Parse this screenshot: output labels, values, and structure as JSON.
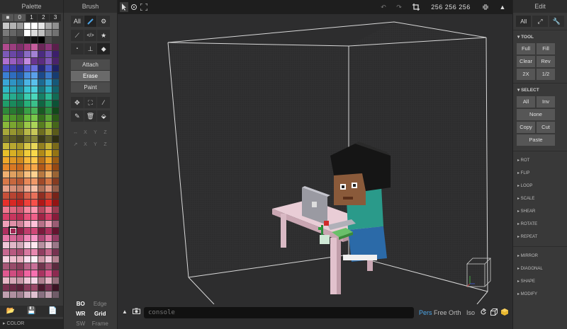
{
  "palette": {
    "title": "Palette",
    "tabs": [
      "■",
      "0",
      "1",
      "2",
      "3"
    ],
    "swatches": [
      "#c9c9c9",
      "#b3b3b3",
      "#9b9b9b",
      "#ffffff",
      "#ffffff",
      "#e6e6e6",
      "#a8a8a8",
      "#909090",
      "#7a7a7a",
      "#666666",
      "#555555",
      "#ffffff",
      "#dcdcdc",
      "#c0c0c0",
      "#828282",
      "#727272",
      "#515151",
      "#3f3f3f",
      "#2f2f2f",
      "#1f1f1f",
      "#111111",
      "#000000",
      "#4b4b4b",
      "#3a3a3a",
      "#b04a8e",
      "#9b3e7f",
      "#7e2f6a",
      "#a33a7e",
      "#c45d9c",
      "#6a2558",
      "#8b3578",
      "#5a1f4b",
      "#7c5ab8",
      "#6a47a6",
      "#5a3793",
      "#8a6bc4",
      "#a382d4",
      "#4a2b80",
      "#6f4fb0",
      "#3c1f6b",
      "#b070d0",
      "#9a5ec0",
      "#8248a8",
      "#c48ae0",
      "#6a3590",
      "#5b2d80",
      "#7e55b4",
      "#4a236b",
      "#4b4fc4",
      "#3d42b0",
      "#2e3398",
      "#5a60d4",
      "#6b72e0",
      "#24287a",
      "#4a5ac8",
      "#1e2266",
      "#3a7fd4",
      "#2f6dbf",
      "#245aa8",
      "#4a90e0",
      "#5aa0ea",
      "#1c4a8a",
      "#3a78c8",
      "#173c70",
      "#3aa6d8",
      "#2f94c4",
      "#2480ae",
      "#4ab4e4",
      "#5ac0ec",
      "#1c6a92",
      "#34a0d0",
      "#165878",
      "#2fb8c8",
      "#26a4b4",
      "#1c8e9e",
      "#3ac6d4",
      "#4ad0dc",
      "#167880",
      "#2ab0c0",
      "#12626a",
      "#2fbfa0",
      "#26ab8e",
      "#1c967a",
      "#3acdb0",
      "#4ad8bc",
      "#168066",
      "#2ab894",
      "#126a54",
      "#1f9e6a",
      "#1a8a5c",
      "#147a50",
      "#26b07a",
      "#3ac08a",
      "#106642",
      "#1e9860",
      "#0c5236",
      "#2e8a3a",
      "#287a32",
      "#206a2a",
      "#38a046",
      "#4ab458",
      "#185a22",
      "#2e8c3c",
      "#12481a",
      "#5aa832",
      "#4e962a",
      "#428224",
      "#68bc3a",
      "#7ac84a",
      "#36701c",
      "#5aa434",
      "#2a5a16",
      "#8ab83a",
      "#7aa630",
      "#6a9228",
      "#9ac848",
      "#aad458",
      "#587e20",
      "#86b436",
      "#46661a",
      "#a8a83a",
      "#969630",
      "#828228",
      "#b8b848",
      "#c8c858",
      "#6e6e20",
      "#a2a236",
      "#5a5a1a",
      "#6a6a2a",
      "#5a5a24",
      "#4a4a1e",
      "#7a7a32",
      "#8a8a3a",
      "#3c3c18",
      "#5e5e28",
      "#2e2e12",
      "#c8b83a",
      "#b8a830",
      "#a89828",
      "#d8c848",
      "#e8d858",
      "#928020",
      "#c4b234",
      "#7a6a1a",
      "#e8c02a",
      "#d8b024",
      "#c8a01e",
      "#f0cc3a",
      "#f8d84a",
      "#b08a18",
      "#e4ba28",
      "#947414",
      "#f0a82a",
      "#e09824",
      "#d0881e",
      "#f8b83a",
      "#ffc84a",
      "#b87018",
      "#eca428",
      "#9a5c14",
      "#e8882a",
      "#d87824",
      "#c8681e",
      "#f0983a",
      "#f8a84a",
      "#b05818",
      "#e48428",
      "#944814",
      "#f0b070",
      "#e0a060",
      "#d09050",
      "#f8c080",
      "#ffd090",
      "#b87840",
      "#eeb26c",
      "#9a6434",
      "#d87848",
      "#c8683e",
      "#b85834",
      "#e88858",
      "#f09868",
      "#a04a2a",
      "#d47444",
      "#863c22",
      "#e8a088",
      "#d89078",
      "#c88068",
      "#f0b098",
      "#f8c0a8",
      "#b07058",
      "#e49c84",
      "#945c48",
      "#c8503a",
      "#b84432",
      "#a8382a",
      "#d8604a",
      "#e8705a",
      "#902e22",
      "#c44c36",
      "#76241a",
      "#e8302a",
      "#d82824",
      "#c8201e",
      "#f0403a",
      "#f8504a",
      "#b01818",
      "#e42c28",
      "#941414",
      "#f07890",
      "#e06880",
      "#d05870",
      "#f888a0",
      "#ff98b0",
      "#b84860",
      "#ec748c",
      "#9a3a50",
      "#d8406a",
      "#c8365e",
      "#b82c52",
      "#e8507a",
      "#f0608a",
      "#a02446",
      "#d43c66",
      "#861c3a",
      "#f0a0b8",
      "#e090a8",
      "#d08098",
      "#f8b0c8",
      "#ffc0d8",
      "#b87088",
      "#ec9cb4",
      "#9a5c74",
      "#b03060",
      "#a02854",
      "#902048",
      "#c03c6c",
      "#d04878",
      "#7a1a3c",
      "#ac2e5c",
      "#641430",
      "#e878a8",
      "#d86898",
      "#c85888",
      "#f088b8",
      "#f898c8",
      "#b04878",
      "#e474a4",
      "#943c64",
      "#f0c8d8",
      "#e0b8c8",
      "#d0a8b8",
      "#f8d8e8",
      "#ffe8f0",
      "#b890a0",
      "#ecc4d4",
      "#9a7888",
      "#c86890",
      "#b85a80",
      "#a84c70",
      "#d878a0",
      "#e888b0",
      "#903e60",
      "#c46489",
      "#763250",
      "#f8d0e0",
      "#f0c0d0",
      "#e8b0c0",
      "#ffe0f0",
      "#fff0f8",
      "#d098a8",
      "#f4cadc",
      "#b48090",
      "#a85878",
      "#984c6a",
      "#88405c",
      "#b86488",
      "#c87098",
      "#70344c",
      "#a45474",
      "#5a2a3e",
      "#e05890",
      "#d04c80",
      "#c04070",
      "#f064a0",
      "#f870b0",
      "#a83460",
      "#dc548c",
      "#8c2a50",
      "#e8b8c8",
      "#d8a8b8",
      "#c898a8",
      "#f0c8d8",
      "#f8d8e8",
      "#b08090",
      "#e4b4c4",
      "#946c7a",
      "#7a3050",
      "#6a2844",
      "#5a2038",
      "#8a3c5c",
      "#9a4868",
      "#4a182c",
      "#763050",
      "#3c1424",
      "#c0a0b0",
      "#b090a0",
      "#a08090",
      "#d0b0c0",
      "#e0c0d0",
      "#887080",
      "#bc9cac",
      "#705c68"
    ],
    "selected_swatch": 233,
    "footer_icons": [
      "folder-open-icon",
      "save-icon",
      "file-icon"
    ],
    "footer_glyphs": [
      "📂",
      "💾",
      "📄"
    ],
    "color_label": "▸ COLOR"
  },
  "brush": {
    "title": "Brush",
    "tab_all": "All",
    "shape_row1": [
      "⟋",
      "</>",
      "★"
    ],
    "shape_row2": [
      "▪",
      "⊥",
      "◆"
    ],
    "actions": [
      "Attach",
      "Erase",
      "Paint"
    ],
    "selected_action": "Erase",
    "transform_row1": [
      "✥",
      "⛶",
      "⁄"
    ],
    "transform_row2": [
      "✎",
      "🗑",
      "⬙"
    ],
    "axes_row1": [
      "↔",
      "X",
      "Y",
      "Z"
    ],
    "axes_row2": [
      "↗",
      "X",
      "Y",
      "Z"
    ],
    "modes": [
      {
        "label": "BO",
        "on": true
      },
      {
        "label": "Edge",
        "on": false
      },
      {
        "label": "WR",
        "on": true
      },
      {
        "label": "Grid",
        "on": true
      },
      {
        "label": "SW",
        "on": false
      },
      {
        "label": "Frame",
        "on": false
      }
    ]
  },
  "viewport": {
    "dimensions": "256 256 256",
    "console_placeholder": "console",
    "projections": [
      "Pers",
      "Free",
      "Orth",
      "Iso"
    ],
    "active_projection": "Pers"
  },
  "edit": {
    "title": "Edit",
    "tool_header": "▾ TOOL",
    "tool_buttons": [
      "Full",
      "Fill",
      "Clear",
      "Rev",
      "2X",
      "1/2"
    ],
    "select_header": "▾ SELECT",
    "select_buttons": [
      "All",
      "Inv"
    ],
    "none_label": "None",
    "copy_cut": [
      "Copy",
      "Cut"
    ],
    "paste_label": "Paste",
    "sections_a": [
      "▸ ROT",
      "▸ FLIP",
      "▸ LOOP",
      "▸ SCALE",
      "▸ SHEAR",
      "▸ ROTATE",
      "▸ REPEAT"
    ],
    "sections_b": [
      "▸ MIRROR",
      "▸ DIAGONAL",
      "▸ SHAPE",
      "▸ MODIFY"
    ]
  }
}
